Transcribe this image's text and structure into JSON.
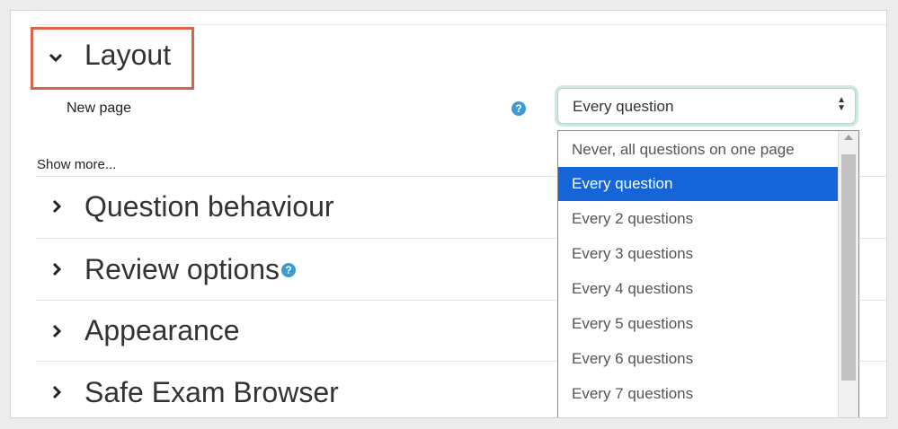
{
  "layout": {
    "title": "Layout",
    "new_page_label": "New page",
    "help_glyph": "?"
  },
  "select": {
    "value": "Every question",
    "arrows": "▲▼"
  },
  "show_more": "Show more...",
  "sections": [
    {
      "title": "Question behaviour"
    },
    {
      "title": "Review options"
    },
    {
      "title": "Appearance"
    },
    {
      "title": "Safe Exam Browser"
    }
  ],
  "dropdown": {
    "options": [
      "Never, all questions on one page",
      "Every question",
      "Every 2 questions",
      "Every 3 questions",
      "Every 4 questions",
      "Every 5 questions",
      "Every 6 questions",
      "Every 7 questions"
    ],
    "selected_index": 1
  },
  "colors": {
    "highlight_border": "#d9624a",
    "selected_option": "#1565d8",
    "help_icon": "#3a9bd5"
  }
}
